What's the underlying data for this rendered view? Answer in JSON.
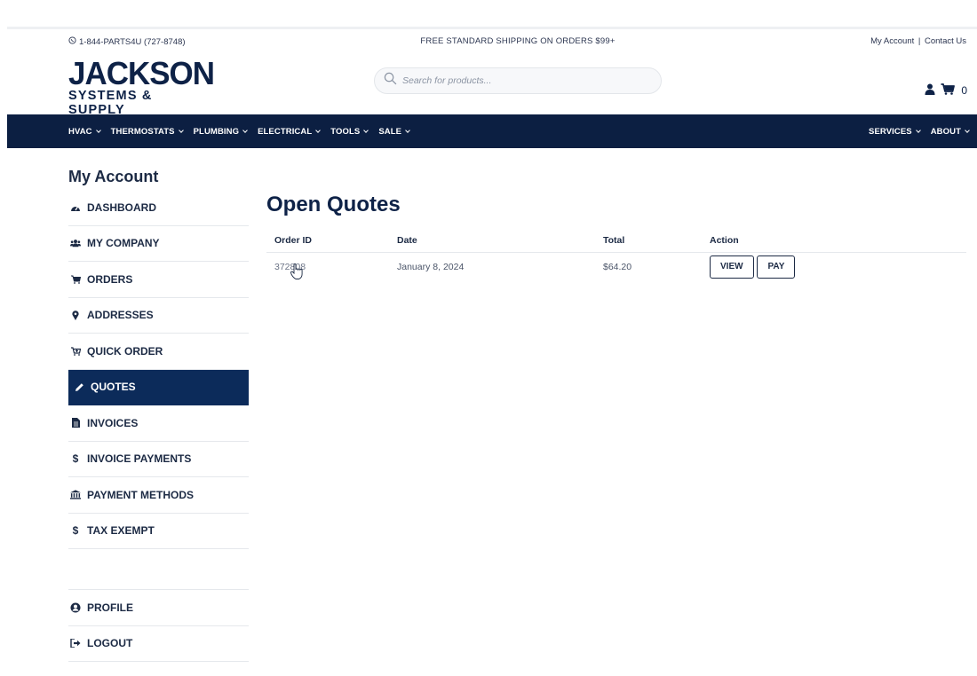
{
  "utility": {
    "phone": "1-844-PARTS4U (727-8748)",
    "shipping": "FREE STANDARD SHIPPING ON ORDERS $99+",
    "my_account": "My Account",
    "separator": "|",
    "contact": "Contact Us"
  },
  "logo": {
    "line1": "JACKSON",
    "line2": "SYSTEMS & SUPPLY"
  },
  "search": {
    "placeholder": "Search for products..."
  },
  "cart": {
    "count": "0"
  },
  "nav": {
    "left": [
      {
        "label": "HVAC"
      },
      {
        "label": "THERMOSTATS"
      },
      {
        "label": "PLUMBING"
      },
      {
        "label": "ELECTRICAL"
      },
      {
        "label": "TOOLS"
      },
      {
        "label": "SALE"
      }
    ],
    "right": [
      {
        "label": "SERVICES"
      },
      {
        "label": "ABOUT"
      }
    ]
  },
  "sidebar": {
    "title": "My Account",
    "items": [
      {
        "label": "DASHBOARD",
        "icon": "dashboard-icon"
      },
      {
        "label": "MY COMPANY",
        "icon": "users-icon"
      },
      {
        "label": "ORDERS",
        "icon": "cart-icon"
      },
      {
        "label": "ADDRESSES",
        "icon": "map-pin-icon"
      },
      {
        "label": "QUICK ORDER",
        "icon": "cart-plus-icon"
      },
      {
        "label": "QUOTES",
        "icon": "pencil-icon",
        "active": true
      },
      {
        "label": "INVOICES",
        "icon": "file-invoice-icon"
      },
      {
        "label": "INVOICE PAYMENTS",
        "icon": "dollar-icon"
      },
      {
        "label": "PAYMENT METHODS",
        "icon": "bank-icon"
      },
      {
        "label": "TAX EXEMPT",
        "icon": "dollar-icon"
      }
    ],
    "bottom": [
      {
        "label": "PROFILE",
        "icon": "user-circle-icon"
      },
      {
        "label": "LOGOUT",
        "icon": "logout-icon"
      }
    ]
  },
  "main": {
    "title": "Open Quotes",
    "columns": [
      "Order ID",
      "Date",
      "Total",
      "Action"
    ],
    "rows": [
      {
        "order_id": "372808",
        "date": "January 8, 2024",
        "total": "$64.20",
        "view": "VIEW",
        "pay": "PAY"
      }
    ]
  },
  "colors": {
    "navy": "#0c1f42",
    "active": "#0c2b5a",
    "text": "#1c2a44"
  }
}
